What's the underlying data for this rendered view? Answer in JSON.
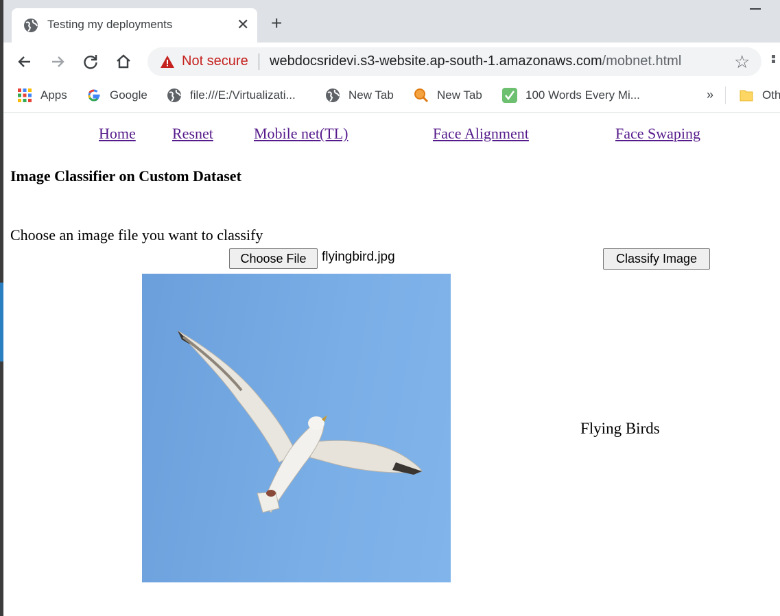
{
  "browser": {
    "tab_title": "Testing my deployments",
    "security_label": "Not secure",
    "url_host": "webdocsridevi.s3-website.ap-south-1.amazonaws.com",
    "url_path": "/mobnet.html"
  },
  "bookmarks": [
    {
      "label": "Apps",
      "icon": "apps-grid-icon"
    },
    {
      "label": "Google",
      "icon": "google-icon"
    },
    {
      "label": "file:///E:/Virtualizati...",
      "icon": "globe-icon"
    },
    {
      "label": "New Tab",
      "icon": "globe-icon"
    },
    {
      "label": "New Tab",
      "icon": "magnifier-icon"
    },
    {
      "label": "100 Words Every Mi...",
      "icon": "checkmark-icon"
    },
    {
      "label": "Oth",
      "icon": "folder-icon"
    }
  ],
  "bookmarks_overflow": "»",
  "nav": {
    "home": "Home",
    "resnet": "Resnet",
    "mobilenet": "Mobile net(TL)",
    "face_alignment": "Face Alignment",
    "face_swaping": "Face Swaping"
  },
  "main": {
    "heading": "Image Classifier on Custom Dataset",
    "prompt": "Choose an image file you want to classify",
    "choose_file_label": "Choose File",
    "file_name": "flyingbird.jpg",
    "classify_label": "Classify Image",
    "result": "Flying Birds"
  },
  "colors": {
    "link_visited": "#551a8b",
    "warning_red": "#c5221f",
    "sky_blue": "#74a9e4"
  }
}
